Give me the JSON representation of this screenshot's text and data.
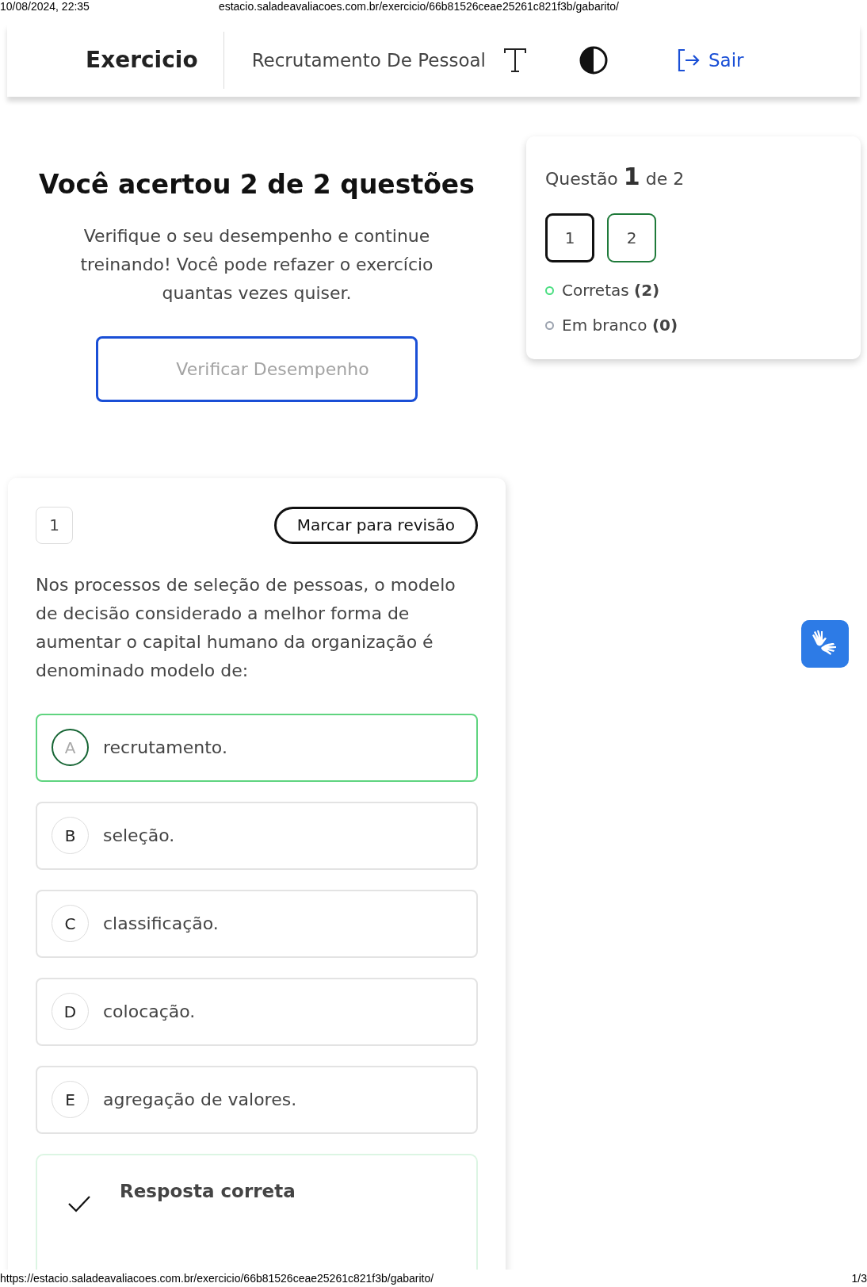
{
  "print_header": {
    "date": "10/08/2024, 22:35",
    "url": "estacio.saladeavaliacoes.com.br/exercicio/66b81526ceae25261c821f3b/gabarito/"
  },
  "nav": {
    "brand": "Exercicio",
    "course": "Recrutamento De Pessoal",
    "logout": "Sair"
  },
  "result": {
    "title": "Você acertou 2 de 2 questões",
    "message": "Verifique o seu desempenho e continue treinando! Você pode refazer o exercício quantas vezes quiser.",
    "button": "Verificar Desempenho"
  },
  "navigator": {
    "label_prefix": "Questão",
    "current": "1",
    "label_suffix": "de 2",
    "questions": [
      {
        "label": "1",
        "selected": true,
        "correct": true
      },
      {
        "label": "2",
        "selected": false,
        "correct": true
      }
    ],
    "legend": [
      {
        "label": "Corretas **(2)**",
        "color": "#4ade80"
      },
      {
        "label": "Em branco **(0)**",
        "color": "#9ca3af"
      }
    ]
  },
  "question": {
    "number": "1",
    "review_button": "Marcar para revisão",
    "text": "Nos processos de seleção de pessoas, o modelo de decisão considerado a melhor forma de aumentar o capital humano da organização é denominado modelo de:",
    "options": [
      {
        "letter": "A",
        "text": "recrutamento.",
        "correct": true
      },
      {
        "letter": "B",
        "text": "seleção.",
        "correct": false
      },
      {
        "letter": "C",
        "text": "classificação.",
        "correct": false
      },
      {
        "letter": "D",
        "text": "colocação.",
        "correct": false
      },
      {
        "letter": "E",
        "text": "agregação de valores.",
        "correct": false
      }
    ],
    "feedback": {
      "title": "Resposta correta"
    }
  },
  "print_footer": {
    "url": "https://estacio.saladeavaliacoes.com.br/exercicio/66b81526ceae25261c821f3b/gabarito/",
    "page": "1/3"
  }
}
